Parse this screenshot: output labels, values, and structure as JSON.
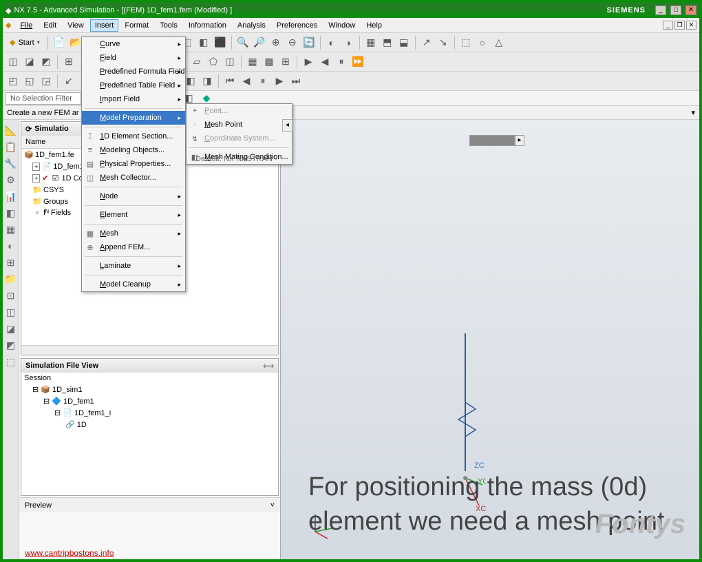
{
  "title": "NX 7.5 - Advanced Simulation - [(FEM) 1D_fem1.fem (Modified) ]",
  "brand": "SIEMENS",
  "menubar": [
    "File",
    "Edit",
    "View",
    "Insert",
    "Format",
    "Tools",
    "Information",
    "Analysis",
    "Preferences",
    "Window",
    "Help"
  ],
  "start_label": "Start",
  "filter": "No Selection Filter",
  "status": "Create a new FEM ar",
  "nav_panel": {
    "title": "Simulatio",
    "col": "Name",
    "items": [
      {
        "icon": "📦",
        "text": "1D_fem1.fe",
        "ind": 0
      },
      {
        "icon": "📄",
        "text": "1D_fem1",
        "ind": 1,
        "exp": "+"
      },
      {
        "icon": "☑",
        "text": "1D Co",
        "ind": 1,
        "exp": "+",
        "red": true
      },
      {
        "icon": "📁",
        "text": "CSYS",
        "ind": 1
      },
      {
        "icon": "📁",
        "text": "Groups",
        "ind": 1
      },
      {
        "icon": "▫",
        "text": "fᴺ Fields",
        "ind": 1
      }
    ]
  },
  "file_view": {
    "title": "Simulation File View",
    "root": "Session",
    "items": [
      "1D_sim1",
      "1D_fem1",
      "1D_fem1_i",
      "1D"
    ]
  },
  "preview": "Preview",
  "insert_menu": {
    "items": [
      {
        "label": "Curve",
        "arrow": true
      },
      {
        "label": "Field",
        "arrow": true
      },
      {
        "label": "Predefined Formula Field",
        "arrow": true
      },
      {
        "label": "Predefined Table Field",
        "arrow": true
      },
      {
        "label": "Import Field",
        "arrow": true
      },
      {
        "sep": true
      },
      {
        "label": "Model Preparation",
        "arrow": true,
        "hi": true
      },
      {
        "sep": true
      },
      {
        "label": "1D Element Section...",
        "icon": "⌶"
      },
      {
        "label": "Modeling Objects...",
        "icon": "≡"
      },
      {
        "label": "Physical Properties...",
        "icon": "▤"
      },
      {
        "label": "Mesh Collector...",
        "icon": "◫"
      },
      {
        "sep": true
      },
      {
        "label": "Node",
        "arrow": true
      },
      {
        "sep": true
      },
      {
        "label": "Element",
        "arrow": true
      },
      {
        "sep": true
      },
      {
        "label": "Mesh",
        "arrow": true,
        "icon": "▦"
      },
      {
        "label": "Append FEM...",
        "icon": "⊕"
      },
      {
        "sep": true
      },
      {
        "label": "Laminate",
        "arrow": true
      },
      {
        "sep": true
      },
      {
        "label": "Model Cleanup",
        "arrow": true
      }
    ]
  },
  "sub_menu": {
    "items": [
      {
        "label": "Point...",
        "icon": "+",
        "dis": true
      },
      {
        "label": "Mesh Point",
        "icon": "·"
      },
      {
        "label": "Coordinate System...",
        "icon": "↯",
        "dis": true
      },
      {
        "sep": true
      },
      {
        "label": "Mesh Mating Condition...",
        "icon": "◧"
      }
    ]
  },
  "default_text": "Default: NX NASTRAN -",
  "axes": {
    "z": "ZC",
    "y": "YC",
    "x": "XC"
  },
  "overlay": "For positioning the mass (0d) element we need a mesh point",
  "watermark": "Fontys",
  "url": "www.cantripbostons.info"
}
